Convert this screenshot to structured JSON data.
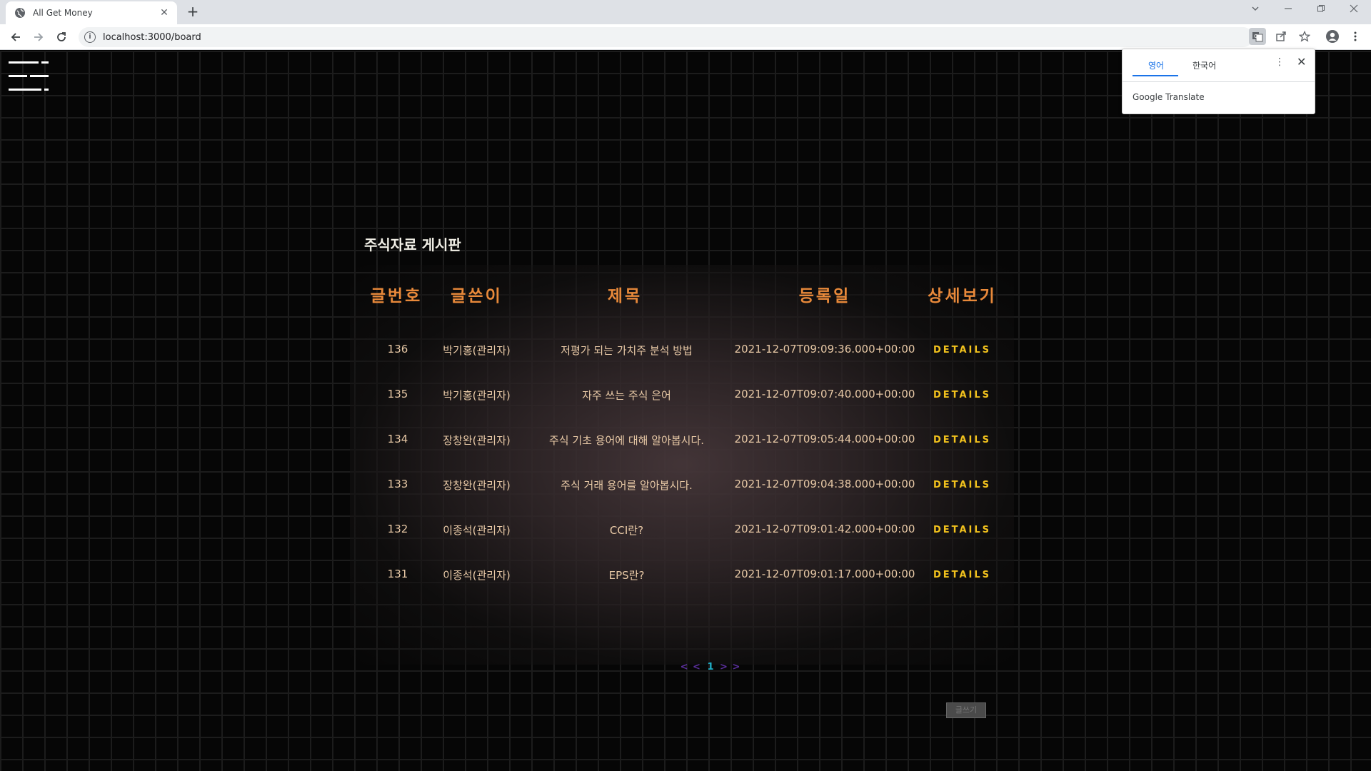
{
  "browser": {
    "tab_title": "All Get Money",
    "url": "localhost:3000/board",
    "new_tab_label": "+",
    "tab_close_label": "✕"
  },
  "translate_popup": {
    "source_lang": "영어",
    "target_lang": "한국어",
    "brand": "Google Translate"
  },
  "board": {
    "title": "주식자료 게시판",
    "columns": [
      "글번호",
      "글쓴이",
      "제목",
      "등록일",
      "상세보기"
    ],
    "rows": [
      {
        "id": "136",
        "author": "박기홍(관리자)",
        "subject": "저평가 되는 가치주 분석 방법",
        "date": "2021-12-07T09:09:36.000+00:00",
        "action": "DETAILS"
      },
      {
        "id": "135",
        "author": "박기홍(관리자)",
        "subject": "자주 쓰는 주식 은어",
        "date": "2021-12-07T09:07:40.000+00:00",
        "action": "DETAILS"
      },
      {
        "id": "134",
        "author": "장창완(관리자)",
        "subject": "주식 기초 용어에 대해 알아봅시다.",
        "date": "2021-12-07T09:05:44.000+00:00",
        "action": "DETAILS"
      },
      {
        "id": "133",
        "author": "장창완(관리자)",
        "subject": "주식 거래 용어를 알아봅시다.",
        "date": "2021-12-07T09:04:38.000+00:00",
        "action": "DETAILS"
      },
      {
        "id": "132",
        "author": "이종석(관리자)",
        "subject": "CCI란?",
        "date": "2021-12-07T09:01:42.000+00:00",
        "action": "DETAILS"
      },
      {
        "id": "131",
        "author": "이종석(관리자)",
        "subject": "EPS란?",
        "date": "2021-12-07T09:01:17.000+00:00",
        "action": "DETAILS"
      }
    ],
    "pagination": {
      "prev": "< <",
      "current": "1",
      "next": "> >"
    },
    "write_button": "글쓰기"
  },
  "colors": {
    "header_accent": "#e8893a",
    "details_accent": "#f2c21d",
    "row_text": "#e8c9a6",
    "pager_current": "#1fb0c8",
    "pager_arrows": "#5a2f9c"
  }
}
